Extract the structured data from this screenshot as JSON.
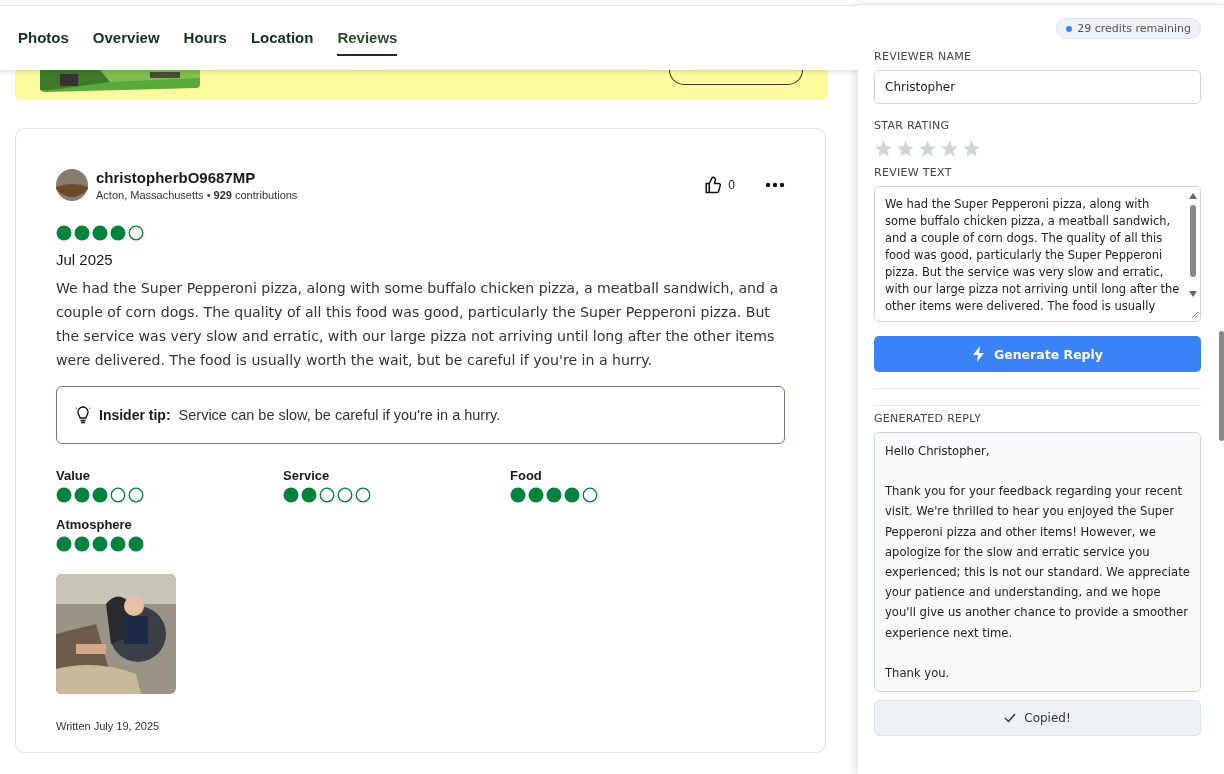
{
  "nav": {
    "tabs": [
      {
        "label": "Photos",
        "selected": false
      },
      {
        "label": "Overview",
        "selected": false
      },
      {
        "label": "Hours",
        "selected": false
      },
      {
        "label": "Location",
        "selected": false
      },
      {
        "label": "Reviews",
        "selected": true
      }
    ]
  },
  "review": {
    "username": "christopherbO9687MP",
    "meta": "Acton, Massachusetts • **929** contributions",
    "likes": "0",
    "stars": 4,
    "date": "Jul 2025",
    "body": "We had the Super Pepperoni pizza, along with some buffalo chicken pizza, a meatball sandwich, and a couple of corn dogs. The quality of all this food was good, particularly the Super Pepperoni pizza. But the service was very slow and erratic, with our large pizza not arriving until long after the other items were delivered. The food is usually worth the wait, but be careful if you're in a hurry.",
    "tip_label": "Insider tip:",
    "tip_text": "Service can be slow, be careful if you're in a hurry.",
    "subratings": [
      {
        "label": "Value",
        "stars": 3
      },
      {
        "label": "Service",
        "stars": 2
      },
      {
        "label": "Food",
        "stars": 4
      },
      {
        "label": "Atmosphere",
        "stars": 5
      }
    ],
    "written": "Written July 19, 2025"
  },
  "panel": {
    "credits": "29 credits remaining",
    "name_label": "REVIEWER NAME",
    "name_value": "Christopher",
    "rating_label": "STAR RATING",
    "stars": 0,
    "text_label": "REVIEW TEXT",
    "review_text": "We had the Super Pepperoni pizza, along with some buffalo chicken pizza, a meatball sandwich, and a couple of corn dogs. The quality of all this food was good, particularly the Super Pepperoni pizza. But the service was very slow and erratic, with our large pizza not arriving until long after the other items were delivered. The food is usually",
    "generate": "Generate Reply",
    "reply_label": "GENERATED REPLY",
    "reply_paragraphs": [
      "Hello Christopher,",
      "Thank you for your feedback regarding your recent visit. We're thrilled to hear you enjoyed the Super Pepperoni pizza and other items! However, we apologize for the slow and erratic service you experienced; this is not our standard. We appreciate your patience and understanding, and we hope you'll give us another chance to provide a smoother experience next time.",
      "Thank you."
    ],
    "copied": "Copied!"
  }
}
